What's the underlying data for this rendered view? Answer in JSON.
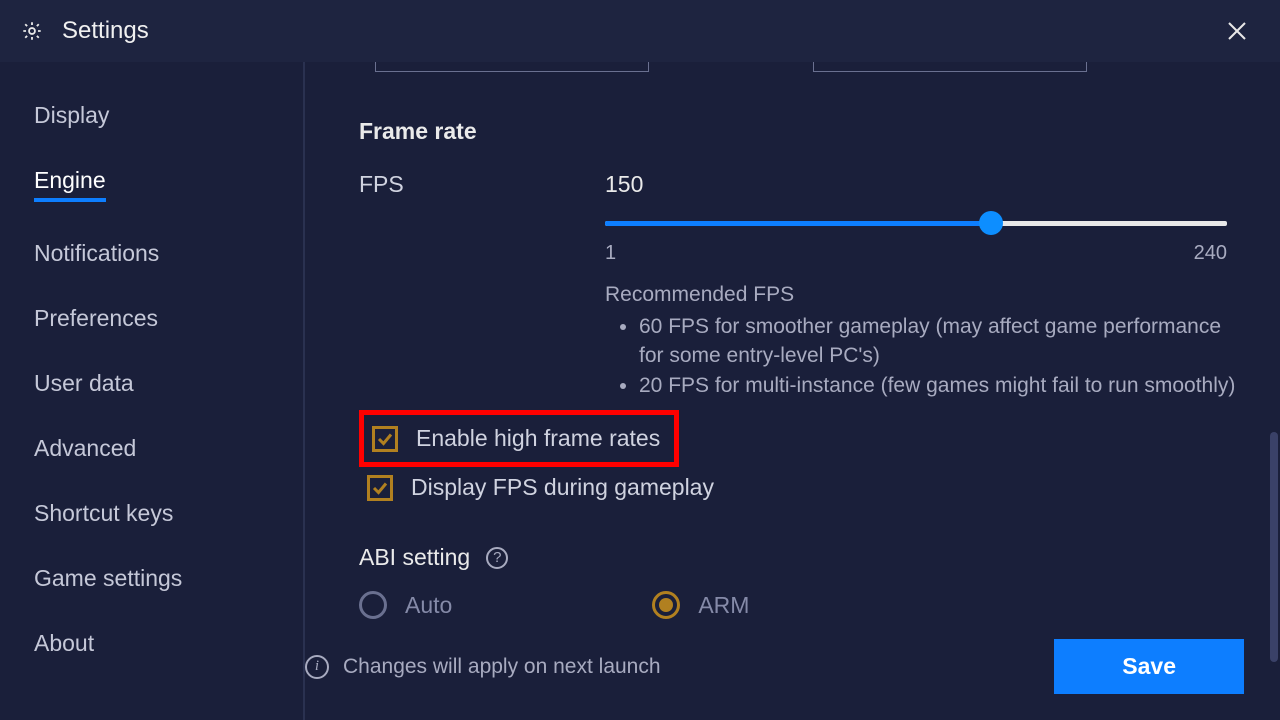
{
  "title": "Settings",
  "sidebar": {
    "items": [
      {
        "label": "Display"
      },
      {
        "label": "Engine",
        "active": true
      },
      {
        "label": "Notifications"
      },
      {
        "label": "Preferences"
      },
      {
        "label": "User data"
      },
      {
        "label": "Advanced"
      },
      {
        "label": "Shortcut keys"
      },
      {
        "label": "Game settings"
      },
      {
        "label": "About"
      }
    ]
  },
  "frame_rate": {
    "section_title": "Frame rate",
    "fps_label": "FPS",
    "value": "150",
    "min": "1",
    "max": "240",
    "percent": 62,
    "recommended_title": "Recommended FPS",
    "recommendations": [
      "60 FPS for smoother gameplay (may affect game performance for some entry-level PC's)",
      "20 FPS for multi-instance (few games might fail to run smoothly)"
    ]
  },
  "checkboxes": {
    "high_fps": {
      "label": "Enable high frame rates",
      "checked": true
    },
    "display_fps": {
      "label": "Display FPS during gameplay",
      "checked": true
    }
  },
  "abi": {
    "title": "ABI setting",
    "options": [
      {
        "label": "Auto",
        "selected": false
      },
      {
        "label": "ARM",
        "selected": true
      }
    ]
  },
  "footer": {
    "note": "Changes will apply on next launch",
    "save": "Save"
  }
}
